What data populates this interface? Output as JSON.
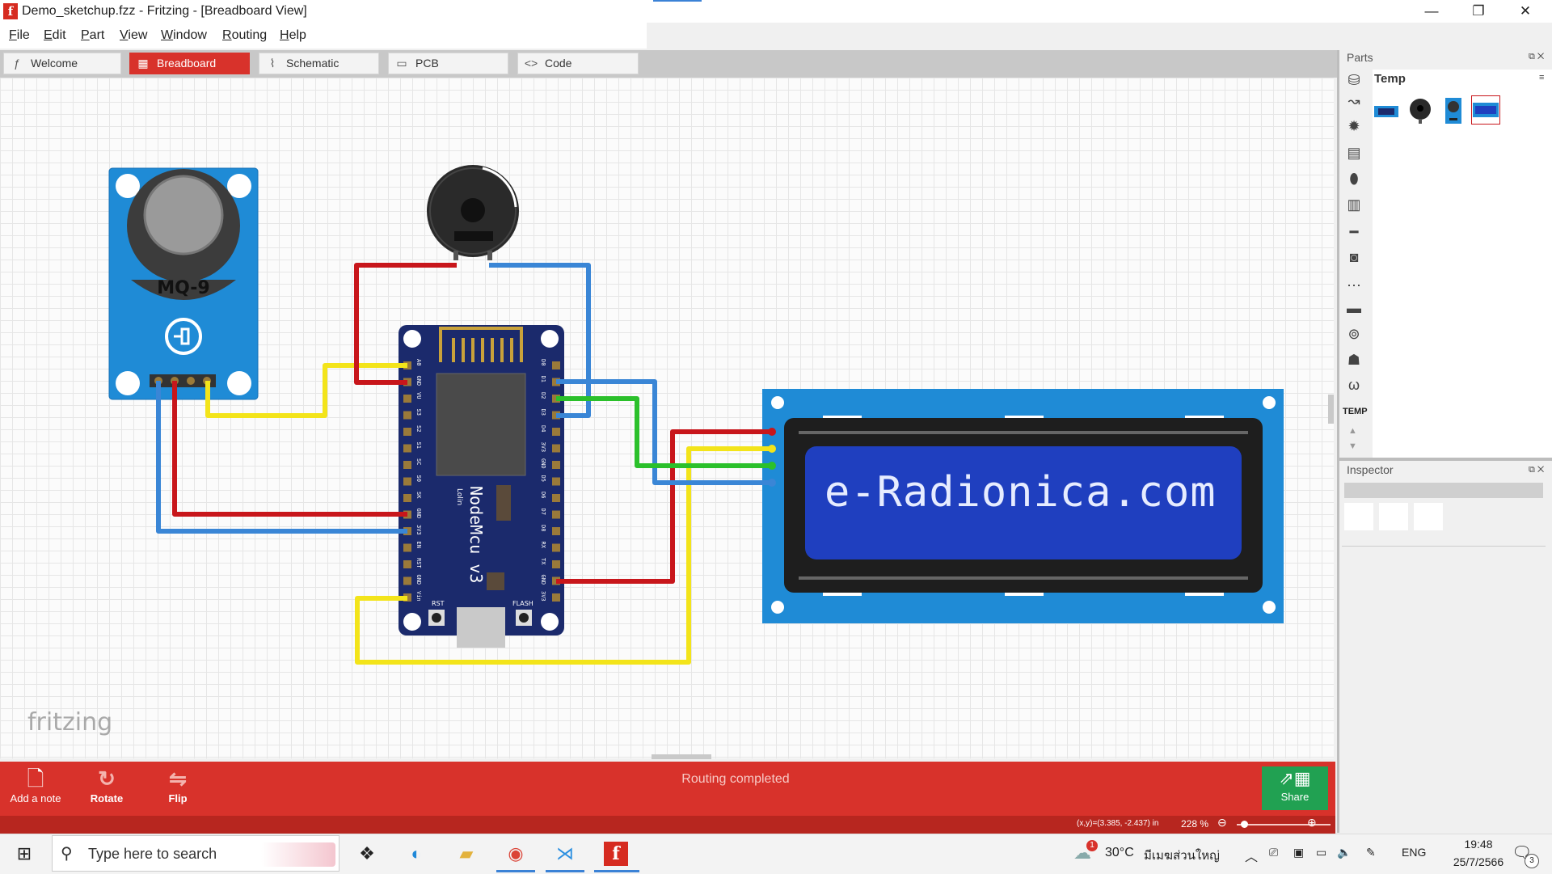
{
  "window": {
    "title": "Demo_sketchup.fzz - Fritzing - [Breadboard View]",
    "app_icon": "f",
    "controls": {
      "minimize": "—",
      "maximize": "❐",
      "close": "✕"
    }
  },
  "menu": [
    {
      "key": "F",
      "rest": "ile"
    },
    {
      "key": "E",
      "rest": "dit"
    },
    {
      "key": "P",
      "rest": "art"
    },
    {
      "key": "V",
      "rest": "iew"
    },
    {
      "key": "W",
      "rest": "indow"
    },
    {
      "key": "R",
      "rest": "outing"
    },
    {
      "key": "H",
      "rest": "elp"
    }
  ],
  "tabs": [
    {
      "label": "Welcome",
      "icon": "fritzing-f-icon",
      "glyph": "ƒ"
    },
    {
      "label": "Breadboard",
      "icon": "breadboard-icon",
      "glyph": "▦",
      "active": true
    },
    {
      "label": "Schematic",
      "icon": "resistor-icon",
      "glyph": "⌇"
    },
    {
      "label": "PCB",
      "icon": "pcb-icon",
      "glyph": "▭"
    },
    {
      "label": "Code",
      "icon": "code-icon",
      "glyph": "<>"
    }
  ],
  "canvas": {
    "sensor_label": "MQ-9",
    "mcu_label": "NodeMcu  v3",
    "mcu_sublabel": "Lolin",
    "rst_label": "RST",
    "flash_label": "FLASH",
    "lcd_text": "e-Radionica.com",
    "watermark": "fritzing",
    "mcu_left_pins": [
      "A0",
      "GND",
      "VU",
      "S3",
      "S2",
      "S1",
      "SC",
      "S0",
      "SK",
      "GND",
      "3V3",
      "EN",
      "RST",
      "GND",
      "Vin"
    ],
    "mcu_right_pins": [
      "D0",
      "D1",
      "D2",
      "D3",
      "D4",
      "3V3",
      "GND",
      "D5",
      "D6",
      "D7",
      "D8",
      "RX",
      "TX",
      "GND",
      "3V3"
    ]
  },
  "parts": {
    "title": "Parts",
    "bin_title": "Temp",
    "temp_label": "TEMP",
    "bin_icons": [
      "core-bin-icon",
      "sparkfun-icon",
      "gear-icon",
      "ic-icon",
      "mouse-icon",
      "chip-icon",
      "resistor-icon",
      "speaker-icon",
      "dots-icon",
      "board-icon",
      "antenna-icon",
      "robot-icon",
      "omega-icon"
    ],
    "temp_parts": [
      "lcd-part-icon",
      "buzzer-part-icon",
      "sensor-part-icon",
      "lcd-display-part-icon"
    ]
  },
  "inspector": {
    "title": "Inspector"
  },
  "toolbar": {
    "add_note": "Add a note",
    "rotate": "Rotate",
    "flip": "Flip",
    "routing_status": "Routing completed",
    "share": "Share"
  },
  "statusbar": {
    "coords": "(x,y)=(3.385, -2.437) in",
    "zoom": "228 %"
  },
  "taskbar": {
    "search_placeholder": "Type here to search",
    "weather": "30°C",
    "weather_location": "มีเมฆส่วนใหญ่",
    "language": "ENG",
    "time": "19:48",
    "date": "25/7/2566",
    "notifications": "3",
    "weather_alert": "1"
  },
  "colors": {
    "accent": "#d8322b",
    "share": "#21a152",
    "wire_red": "#c8161b",
    "wire_blue": "#3a86d6",
    "wire_yellow": "#f3e41a",
    "wire_green": "#2bc02b",
    "board_blue": "#1f8bd6",
    "mcu_navy": "#1b2a6c"
  }
}
